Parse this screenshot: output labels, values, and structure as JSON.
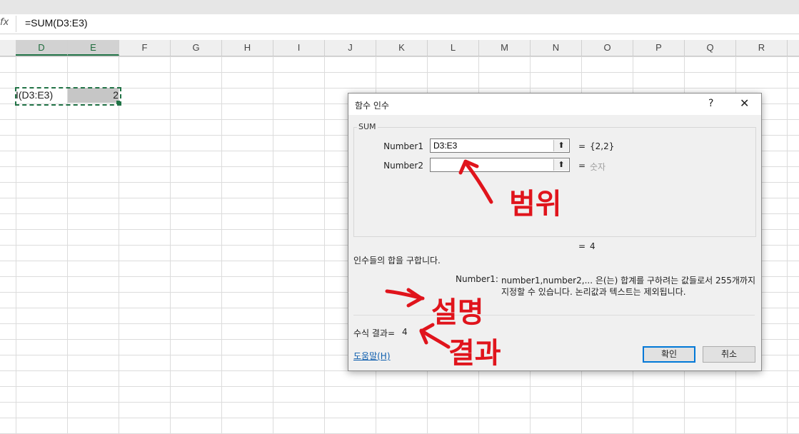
{
  "formula_bar": {
    "fx_label": "fx",
    "formula": "=SUM(D3:E3)"
  },
  "columns": [
    "D",
    "E",
    "F",
    "G",
    "H",
    "I",
    "J",
    "K",
    "L",
    "M",
    "N",
    "O",
    "P",
    "Q",
    "R"
  ],
  "cells": {
    "d3": "I(D3:E3)",
    "e3": "2"
  },
  "dialog": {
    "title": "함수 인수",
    "help_symbol": "?",
    "close_symbol": "✕",
    "function_name": "SUM",
    "args": [
      {
        "name": "Number1",
        "value": "D3:E3",
        "eq": "=",
        "result": "{2,2}"
      },
      {
        "name": "Number2",
        "value": "",
        "eq": "=",
        "result": "숫자"
      }
    ],
    "overall_eq": "=",
    "overall_result": "4",
    "description": "인수들의 합을 구합니다.",
    "arg_help_name": "Number1:",
    "arg_help_line1": "number1,number2,... 은(는) 합계를 구하려는 값들로서 255개까지",
    "arg_help_line2": "지정할 수 있습니다. 논리값과 텍스트는 제외됩니다.",
    "formula_result_label": "수식 결과=",
    "formula_result_value": "4",
    "help_link": "도움말(H)",
    "ok_label": "확인",
    "cancel_label": "취소"
  },
  "annotations": {
    "range": "범위",
    "explanation": "설명",
    "result": "결과",
    "color": "#e0141c"
  }
}
